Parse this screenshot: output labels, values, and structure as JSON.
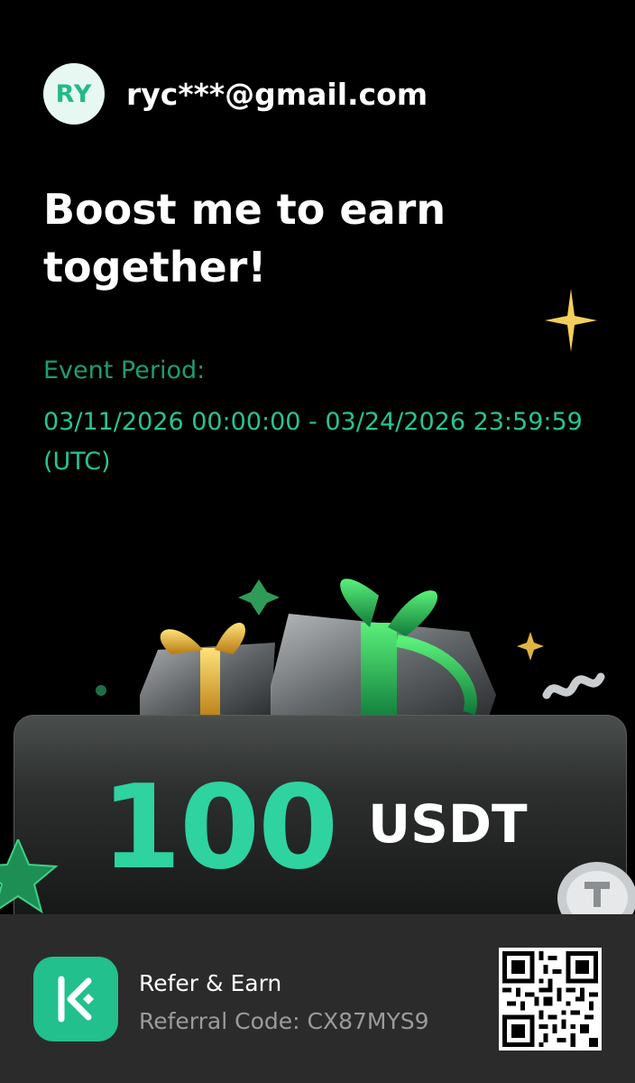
{
  "user": {
    "avatar_initials": "RY",
    "email": "ryc***@gmail.com"
  },
  "headline": "Boost me to earn together!",
  "event": {
    "label": "Event Period:",
    "period": "03/11/2026 00:00:00 - 03/24/2026 23:59:59 (UTC)"
  },
  "reward": {
    "amount": "100",
    "unit": "USDT"
  },
  "footer": {
    "title": "Refer & Earn",
    "referral_code": "Referral Code: CX87MYS9",
    "app_icon": "kucoin-logo-icon",
    "qr_icon": "qr-code-icon"
  },
  "colors": {
    "accent": "#2ed3a0",
    "event_label": "#1f9c74",
    "background": "#000000",
    "footer_bg": "#2b2b2c"
  }
}
